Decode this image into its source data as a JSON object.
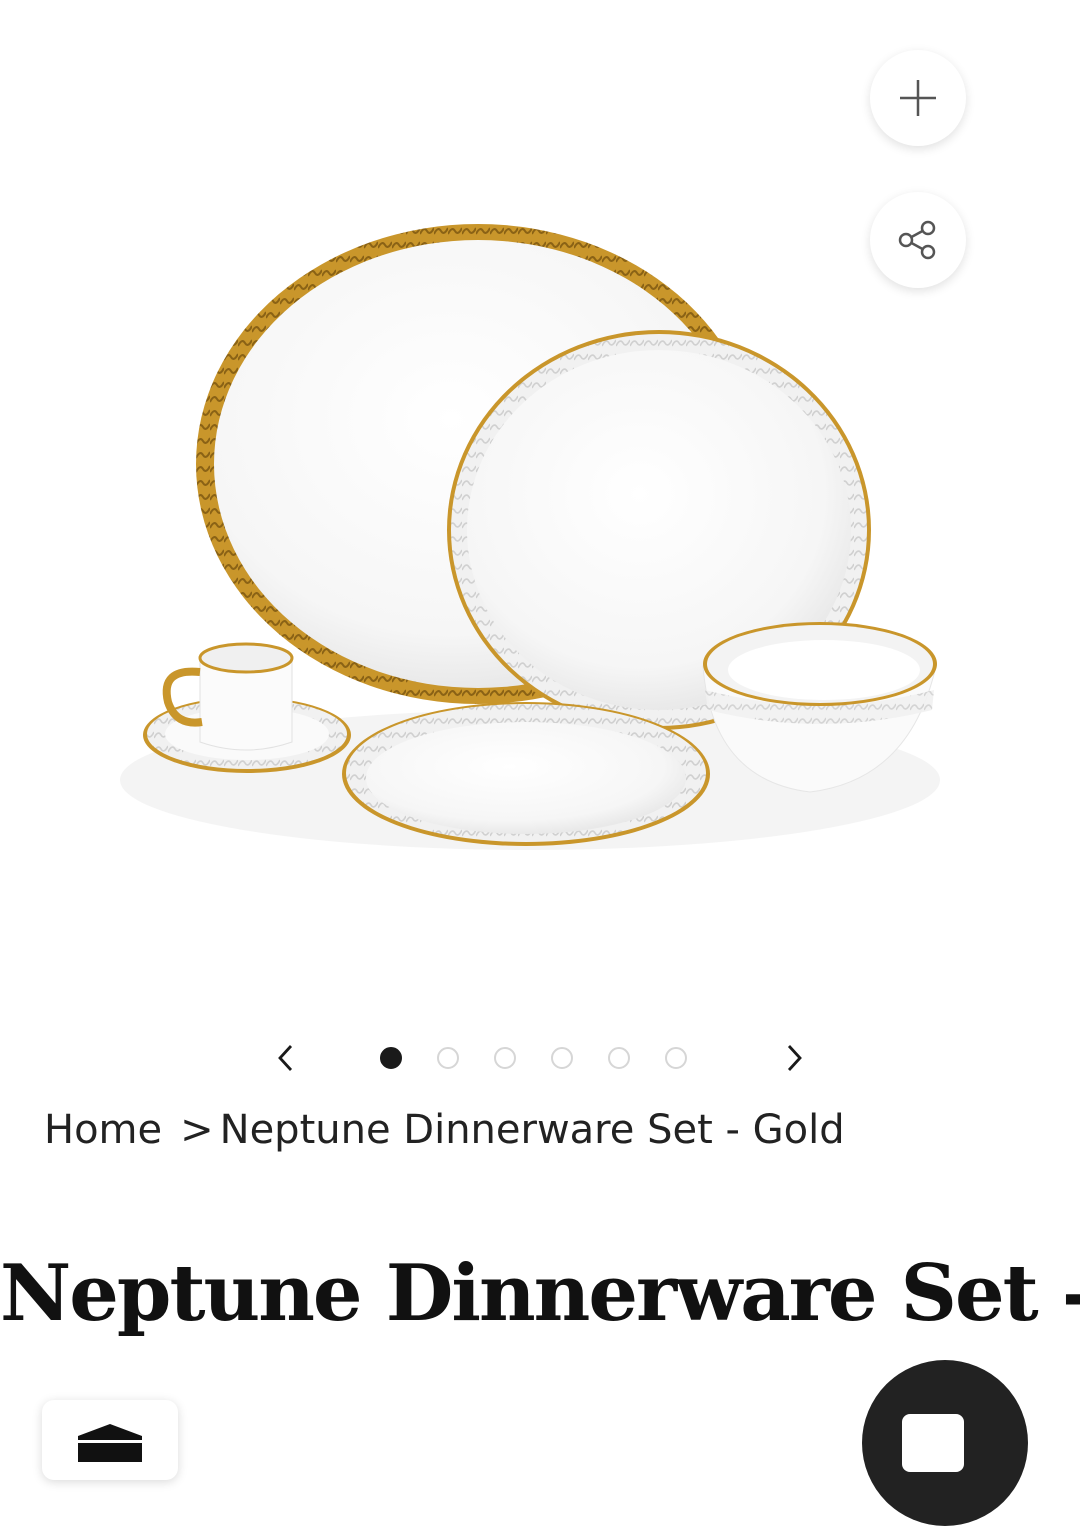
{
  "gallery": {
    "image_alt": "Neptune Dinnerware Set - Gold",
    "slide_count": 6,
    "active_slide": 1,
    "zoom_icon": "plus-icon",
    "share_icon": "share-icon",
    "prev_icon": "chevron-left-icon",
    "next_icon": "chevron-right-icon"
  },
  "breadcrumb": {
    "home": "Home",
    "separator": ">",
    "current": "Neptune Dinnerware Set - Gold"
  },
  "product": {
    "title": "Neptune Dinnerware Set -"
  },
  "colors": {
    "gold": "#c9962b",
    "dark": "#1a1a1a",
    "fab": "#222222"
  }
}
